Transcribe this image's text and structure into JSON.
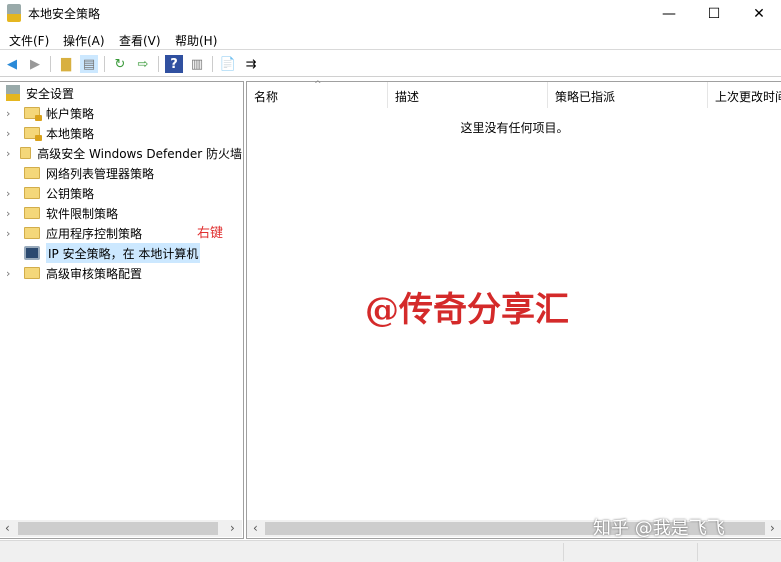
{
  "window": {
    "title": "本地安全策略",
    "minimize": "—",
    "maximize": "☐",
    "close": "✕"
  },
  "menu": [
    "文件(F)",
    "操作(A)",
    "查看(V)",
    "帮助(H)"
  ],
  "tree": {
    "root": "安全设置",
    "items": [
      {
        "label": "帐户策略",
        "expandable": true,
        "icon": "folder-lock-icon"
      },
      {
        "label": "本地策略",
        "expandable": true,
        "icon": "folder-lock-icon"
      },
      {
        "label": "高级安全 Windows Defender 防火墙",
        "expandable": true,
        "icon": "folder-icon"
      },
      {
        "label": "网络列表管理器策略",
        "expandable": false,
        "icon": "folder-icon"
      },
      {
        "label": "公钥策略",
        "expandable": true,
        "icon": "folder-icon"
      },
      {
        "label": "软件限制策略",
        "expandable": true,
        "icon": "folder-icon"
      },
      {
        "label": "应用程序控制策略",
        "expandable": true,
        "icon": "folder-icon"
      },
      {
        "label": "IP 安全策略，在 本地计算机",
        "expandable": false,
        "icon": "ip-security-icon",
        "selected": true
      },
      {
        "label": "高级审核策略配置",
        "expandable": true,
        "icon": "folder-icon"
      }
    ]
  },
  "annotation": {
    "right_click": "右键",
    "color": "#e03030"
  },
  "list": {
    "columns": [
      "名称",
      "描述",
      "策略已指派",
      "上次更改时间"
    ],
    "empty": "这里没有任何项目。"
  },
  "watermarks": {
    "center": "@传奇分享汇",
    "bottom": "知乎 @我是飞飞"
  }
}
